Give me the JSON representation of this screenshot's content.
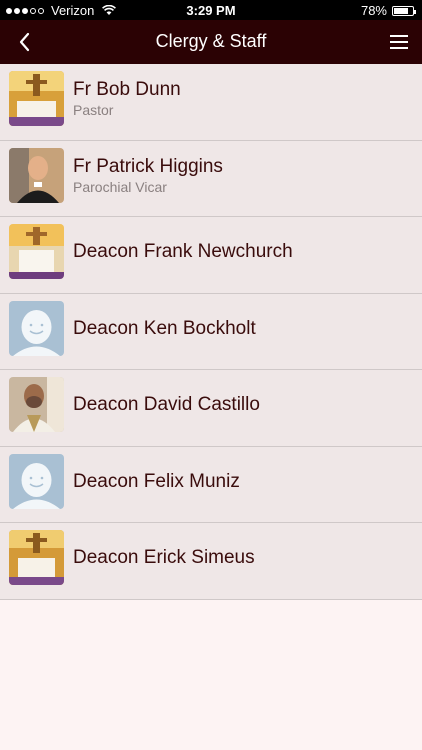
{
  "status_bar": {
    "carrier": "Verizon",
    "time": "3:29 PM",
    "battery": "78%",
    "battery_level": 0.78
  },
  "navbar": {
    "title": "Clergy & Staff"
  },
  "staff": [
    {
      "name": "Fr Bob Dunn",
      "role": "Pastor",
      "photo": "altar-photo"
    },
    {
      "name": "Fr Patrick Higgins",
      "role": "Parochial Vicar",
      "photo": "portrait-photo"
    },
    {
      "name": "Deacon Frank Newchurch",
      "role": "",
      "photo": "altar-photo"
    },
    {
      "name": "Deacon Ken Bockholt",
      "role": "",
      "photo": "placeholder"
    },
    {
      "name": "Deacon David Castillo",
      "role": "",
      "photo": "portrait-photo"
    },
    {
      "name": "Deacon Felix Muniz",
      "role": "",
      "photo": "placeholder"
    },
    {
      "name": "Deacon Erick Simeus",
      "role": "",
      "photo": "altar-photo"
    }
  ]
}
